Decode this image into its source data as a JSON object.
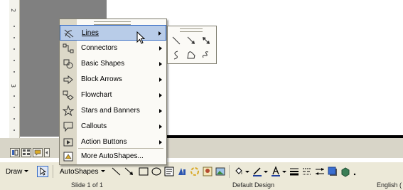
{
  "ruler": {
    "marks": [
      "2",
      "3"
    ]
  },
  "menu": {
    "items": [
      {
        "label": "Lines",
        "icon": "lines-icon",
        "submenu": true,
        "highlighted": true
      },
      {
        "label": "Connectors",
        "icon": "connectors-icon",
        "submenu": true
      },
      {
        "label": "Basic Shapes",
        "icon": "basic-shapes-icon",
        "submenu": true
      },
      {
        "label": "Block Arrows",
        "icon": "block-arrows-icon",
        "submenu": true
      },
      {
        "label": "Flowchart",
        "icon": "flowchart-icon",
        "submenu": true
      },
      {
        "label": "Stars and Banners",
        "icon": "stars-banners-icon",
        "submenu": true
      },
      {
        "label": "Callouts",
        "icon": "callouts-icon",
        "submenu": true
      },
      {
        "label": "Action Buttons",
        "icon": "action-buttons-icon",
        "submenu": true
      },
      {
        "label": "More AutoShapes...",
        "icon": "more-autoshapes-icon",
        "submenu": false
      }
    ]
  },
  "submenu": {
    "tools": [
      "line-icon",
      "arrow-icon",
      "double-arrow-icon",
      "curve-icon",
      "freeform-icon",
      "scribble-icon"
    ]
  },
  "toolbar": {
    "draw_label": "Draw",
    "autoshapes_label": "AutoShapes",
    "tools": [
      "line-icon",
      "arrow-icon",
      "rectangle-icon",
      "oval-icon",
      "text-box-icon",
      "wordart-icon",
      "diagram-icon",
      "clip-art-icon",
      "picture-icon",
      "fill-color-icon",
      "line-color-icon",
      "font-color-icon",
      "line-style-icon",
      "dash-style-icon",
      "arrow-style-icon",
      "shadow-icon",
      "3d-icon"
    ]
  },
  "status": {
    "slide": "Slide 1 of 1",
    "design": "Default Design",
    "language": "English ("
  },
  "colors": {
    "menu_highlight": "#b8cce8",
    "menu_highlight_border": "#3167c3",
    "toolbar_bg": "#ece9d8",
    "workspace": "#808080"
  }
}
